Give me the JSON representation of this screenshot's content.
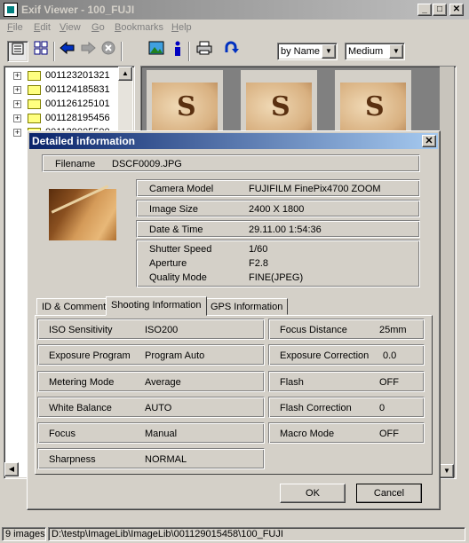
{
  "app": {
    "title": "Exif Viewer - 100_FUJI"
  },
  "window_buttons": {
    "minimize": "_",
    "maximize": "□",
    "close": "✕"
  },
  "menu": [
    {
      "label": "File",
      "mn": "F",
      "rest": "ile"
    },
    {
      "label": "Edit",
      "mn": "E",
      "rest": "dit"
    },
    {
      "label": "View",
      "mn": "V",
      "rest": "iew"
    },
    {
      "label": "Go",
      "mn": "G",
      "rest": "o"
    },
    {
      "label": "Bookmarks",
      "mn": "B",
      "rest": "ookmarks"
    },
    {
      "label": "Help",
      "mn": "H",
      "rest": "elp"
    }
  ],
  "toolbar": {
    "sort_value": "by Name",
    "size_value": "Medium",
    "icons": [
      "details-view-icon",
      "thumbnail-view-icon",
      "back-arrow-icon",
      "forward-arrow-icon",
      "stop-icon",
      "image-icon",
      "info-icon",
      "print-icon",
      "rotate-icon"
    ]
  },
  "tree": {
    "items": [
      "001123201321",
      "001124185831",
      "001126125101",
      "001128195456",
      "001129005500"
    ]
  },
  "dialog": {
    "title": "Detailed information",
    "close": "✕",
    "filename_label": "Filename",
    "filename_value": "DSCF0009.JPG",
    "camera_model_label": "Camera Model",
    "camera_model_value": "FUJIFILM FinePix4700 ZOOM",
    "image_size_label": "Image Size",
    "image_size_value": "2400 X 1800",
    "datetime_label": "Date & Time",
    "datetime_value": "29.11.00 1:54:36",
    "shutter_label": "Shutter Speed",
    "shutter_value": "1/60",
    "aperture_label": "Aperture",
    "aperture_value": "F2.8",
    "quality_label": "Quality Mode",
    "quality_value": "FINE(JPEG)",
    "tabs": [
      "ID & Comment",
      "Shooting Information",
      "GPS Information"
    ],
    "left_rows": [
      {
        "k": "ISO Sensitivity",
        "v": "ISO200"
      },
      {
        "k": "Exposure Program",
        "v": "Program Auto"
      },
      {
        "k": "Metering Mode",
        "v": "Average"
      },
      {
        "k": "White Balance",
        "v": "AUTO"
      },
      {
        "k": "Focus",
        "v": "Manual"
      },
      {
        "k": "Sharpness",
        "v": "NORMAL"
      }
    ],
    "right_rows": [
      {
        "k": "Focus Distance",
        "v": "25mm"
      },
      {
        "k": "Exposure Correction",
        "v": "0.0"
      },
      {
        "k": "Flash",
        "v": "OFF"
      },
      {
        "k": "Flash Correction",
        "v": "0"
      },
      {
        "k": "Macro Mode",
        "v": "OFF"
      }
    ],
    "ok": "OK",
    "cancel": "Cancel"
  },
  "status": {
    "count": "9 images",
    "path": "D:\\testp\\ImageLib\\ImageLib\\001129015458\\100_FUJI"
  }
}
